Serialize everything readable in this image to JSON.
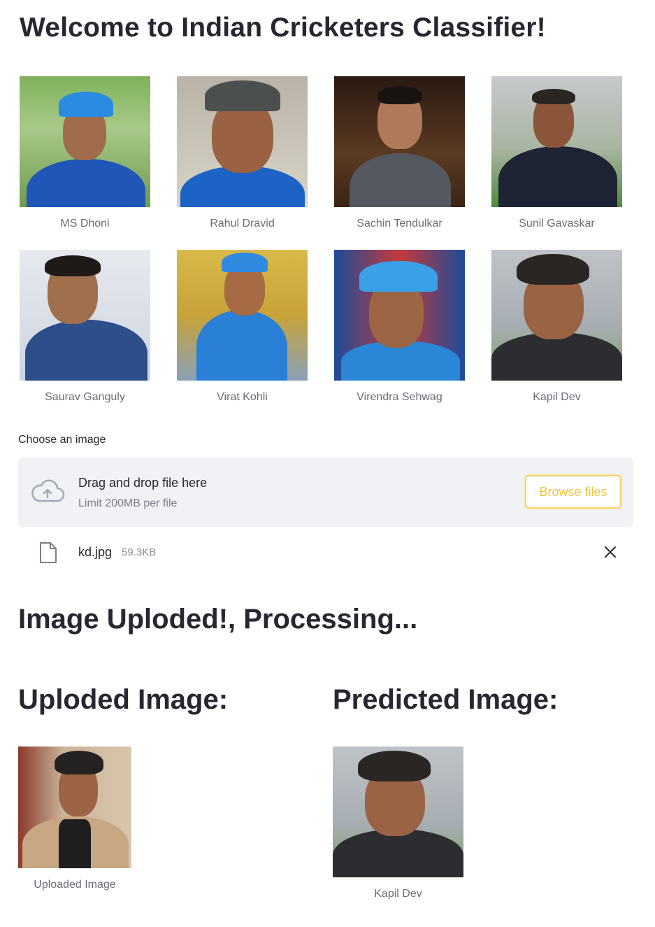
{
  "title": "Welcome to Indian Cricketers Classifier!",
  "players": [
    {
      "name": "MS Dhoni"
    },
    {
      "name": "Rahul Dravid"
    },
    {
      "name": "Sachin Tendulkar"
    },
    {
      "name": "Sunil Gavaskar"
    },
    {
      "name": "Saurav Ganguly"
    },
    {
      "name": "Virat Kohli"
    },
    {
      "name": "Virendra Sehwag"
    },
    {
      "name": "Kapil Dev"
    }
  ],
  "uploader": {
    "label": "Choose an image",
    "drag_text": "Drag and drop file here",
    "limit_text": "Limit 200MB per file",
    "browse_label": "Browse files",
    "icon": "cloud-upload-icon"
  },
  "file": {
    "name": "kd.jpg",
    "size": "59.3KB"
  },
  "status": "Image Uploded!, Processing...",
  "results": {
    "uploaded_heading": "Uploded Image:",
    "predicted_heading": "Predicted Image:",
    "uploaded_caption": "Uploaded Image",
    "predicted_caption": "Kapil Dev"
  },
  "colors": {
    "accent": "#f7d46a",
    "dropzone_bg": "#f0f2f6",
    "text": "#262730",
    "caption": "#6b6b78"
  }
}
